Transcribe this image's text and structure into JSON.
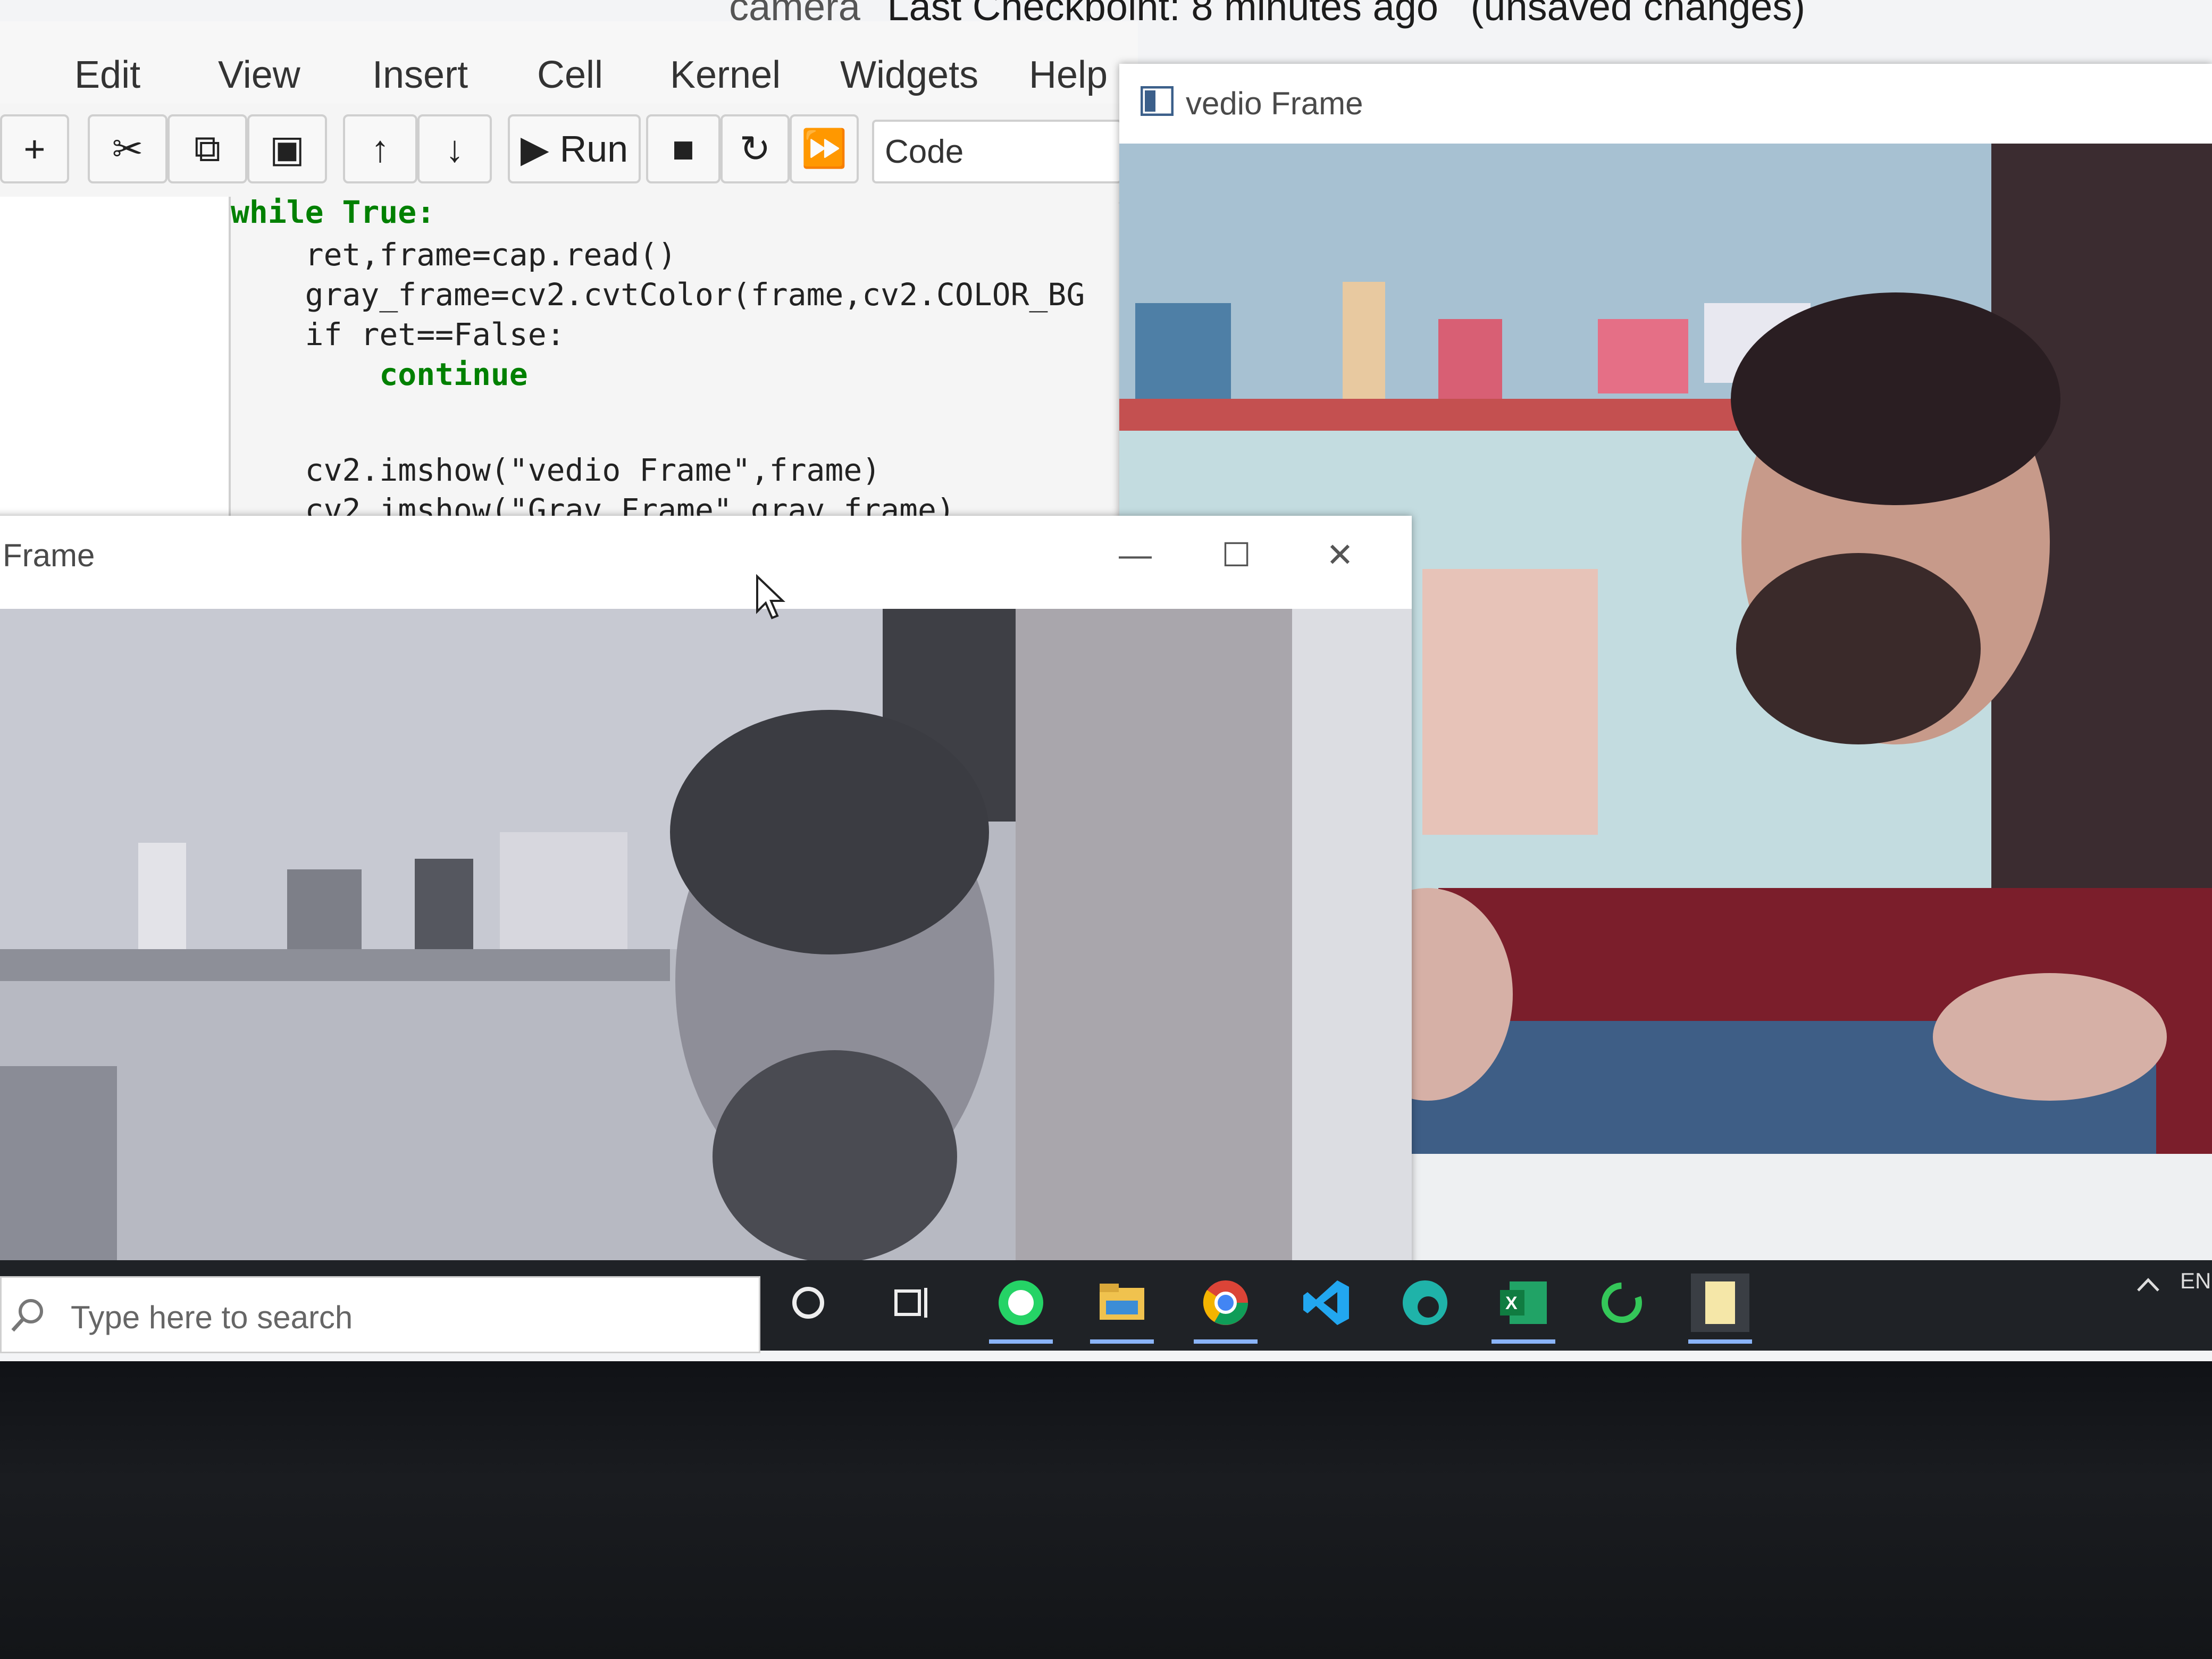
{
  "notebook": {
    "title_partial": "_camera",
    "checkpoint": "Last Checkpoint: 8 minutes ago",
    "status": "(unsaved changes)"
  },
  "menu": [
    "Edit",
    "View",
    "Insert",
    "Cell",
    "Kernel",
    "Widgets",
    "Help"
  ],
  "toolbar": {
    "run_label": "Run",
    "cell_type": "Code",
    "icons": [
      "plus-icon",
      "scissors-icon",
      "copy-icon",
      "paste-icon",
      "arrow-up-icon",
      "arrow-down-icon",
      "run-icon",
      "stop-icon",
      "restart-icon",
      "fast-forward-icon"
    ]
  },
  "code": [
    "while True:",
    "    ret,frame=cap.read()",
    "    gray_frame=cv2.cvtColor(frame,cv2.COLOR_BG",
    "    if ret==False:",
    "        continue",
    "",
    "    cv2.imshow(\"vedio Frame\",frame)",
    "    cv2.imshow(\"Grav Frame\",grav frame)"
  ],
  "windows": {
    "color_window_title": "vedio Frame",
    "gray_window_title": "Frame"
  },
  "taskbar": {
    "search_placeholder": "Type here to search",
    "tray_label": "ENG",
    "apps": [
      "cortana-icon",
      "task-view-icon",
      "whatsapp-icon",
      "file-explorer-icon",
      "chrome-icon",
      "vscode-icon",
      "edge-icon",
      "excel-icon",
      "app-ring-icon",
      "notepad-icon"
    ]
  },
  "colors": {
    "taskbar": "#1f2226",
    "jupyter_bg": "#f7f7f7",
    "code_keyword": "#008000",
    "code_string": "#ba2121"
  }
}
